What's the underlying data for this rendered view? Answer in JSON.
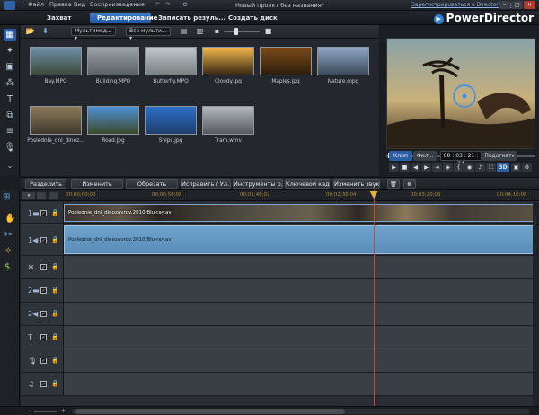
{
  "menu": [
    "Файл",
    "Правка",
    "Вид",
    "Воспроизведение"
  ],
  "window_title": "Новый проект без названия*",
  "directorzone_link": "Зарегистрироваться в DirectorZone",
  "brand": "PowerDirector",
  "modes": [
    {
      "label": "Захват",
      "active": false
    },
    {
      "label": "Редактирование",
      "active": true
    },
    {
      "label": "Записать резуль...",
      "active": false
    },
    {
      "label": "Создать диск",
      "active": false
    }
  ],
  "library": {
    "filter1": "Мультимед...",
    "filter2": "Все мульти...",
    "items": [
      {
        "name": "Bay.MPO",
        "c1": "#6f8fa8",
        "c2": "#3b4a3a"
      },
      {
        "name": "Building.MPO",
        "c1": "#9aa3a8",
        "c2": "#5c6166"
      },
      {
        "name": "Butterfly.MPO",
        "c1": "#c0c6c9",
        "c2": "#7a7f82"
      },
      {
        "name": "Cloudy.jpg",
        "c1": "#f2b64a",
        "c2": "#3a2a14"
      },
      {
        "name": "Maples.jpg",
        "c1": "#7a4a18",
        "c2": "#2d1e0c"
      },
      {
        "name": "Nature.mpg",
        "c1": "#8da6c4",
        "c2": "#3d4a5a"
      },
      {
        "name": "Poslednie_dni_dinoz...",
        "c1": "#8b7a5a",
        "c2": "#3f3a2c"
      },
      {
        "name": "Road.jpg",
        "c1": "#4f8fd6",
        "c2": "#3a4a2a"
      },
      {
        "name": "Ships.jpg",
        "c1": "#2e6fc8",
        "c2": "#1f3f6a"
      },
      {
        "name": "Tram.wmv",
        "c1": "#b3b8bc",
        "c2": "#55595d"
      }
    ]
  },
  "preview": {
    "tab_clip": "Клип",
    "tab_film": "Фил...",
    "timecode": "00 : 03 : 21 : 24",
    "fit": "Подогнат",
    "mode3d": "3D"
  },
  "editbar": [
    "Разделить",
    "Изменить",
    "Обрезать",
    "Исправить / Ул...",
    "Инструменты р...",
    "Ключевой кадр",
    "Изменить звук"
  ],
  "ruler": [
    "00;00;00;00",
    "00;00;58;08",
    "00;01;40;02",
    "00;02;30;04",
    "00;03;20;06",
    "00;04;10;08"
  ],
  "timeline": {
    "video_clip": "Poslednie_dni_dinozavrov.2010.Blu-ray.avi",
    "audio_clip": "Poslednie_dni_dinozavrov.2010.Blu-ray.avi",
    "playhead": 0.66
  }
}
